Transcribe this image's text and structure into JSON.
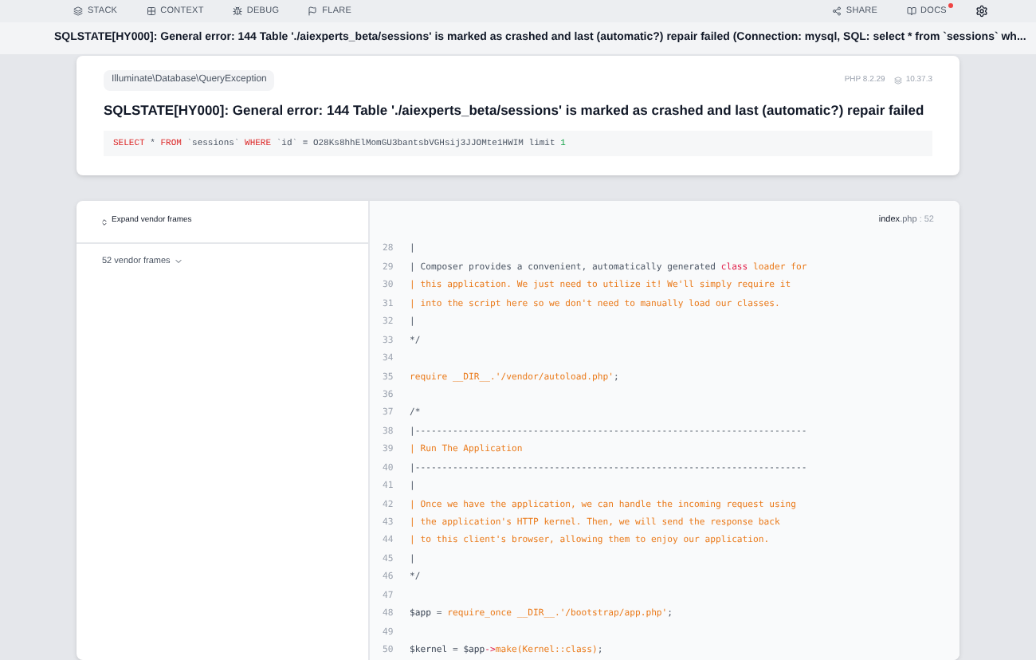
{
  "nav": {
    "tabs": [
      {
        "label": "STACK",
        "kind": "stack"
      },
      {
        "label": "CONTEXT",
        "kind": "context"
      },
      {
        "label": "DEBUG",
        "kind": "debug"
      },
      {
        "label": "FLARE",
        "kind": "flare"
      }
    ],
    "share": "SHARE",
    "docs": "DOCS"
  },
  "title_bar": "SQLSTATE[HY000]: General error: 144 Table './aiexperts_beta/sessions' is marked as crashed and last (automatic?) repair failed (Connection: mysql, SQL: select * from `sessions` wh...",
  "exception": {
    "class": "Illuminate\\Database\\QueryException",
    "php_version": "PHP 8.2.29",
    "laravel_version": "10.37.3",
    "message": "SQLSTATE[HY000]: General error: 144 Table './aiexperts_beta/sessions' is marked as crashed and last (automatic?) repair failed",
    "sql": [
      {
        "text": "SELECT",
        "kind": "keyword"
      },
      {
        "text": " * ",
        "kind": "plain"
      },
      {
        "text": "FROM",
        "kind": "keyword"
      },
      {
        "text": " `sessions` ",
        "kind": "plain"
      },
      {
        "text": "WHERE",
        "kind": "keyword"
      },
      {
        "text": " `id` = O28Ks8hhElMomGU3bantsbVGHsij3JJOMte1HWIM limit ",
        "kind": "plain"
      },
      {
        "text": "1",
        "kind": "number"
      }
    ]
  },
  "frames": {
    "expand_button": "Expand vendor frames",
    "vendor_frames": "52 vendor frames"
  },
  "code": {
    "file": "index",
    "ext": ".php",
    "line": ": 52",
    "lines": [
      {
        "number": "28",
        "segments": [
          {
            "text": "|",
            "kind": "plain"
          }
        ]
      },
      {
        "number": "29",
        "segments": [
          {
            "text": "| Composer provides a convenient, automatically generated ",
            "kind": "plain"
          },
          {
            "text": "class ",
            "kind": "keyword"
          },
          {
            "text": "loader for",
            "kind": "doc"
          }
        ]
      },
      {
        "number": "30",
        "segments": [
          {
            "text": "| this application. We just need to utilize it! We'll simply require it",
            "kind": "doc"
          }
        ]
      },
      {
        "number": "31",
        "segments": [
          {
            "text": "| into the script here so we don't need to manually load our classes.",
            "kind": "doc"
          }
        ]
      },
      {
        "number": "32",
        "segments": [
          {
            "text": "|",
            "kind": "plain"
          }
        ]
      },
      {
        "number": "33",
        "segments": [
          {
            "text": "*/",
            "kind": "plain"
          }
        ]
      },
      {
        "number": "34"
      },
      {
        "number": "35",
        "segments": [
          {
            "text": "require __DIR__.'/vendor/autoload.php'",
            "kind": "doc"
          },
          {
            "text": ";",
            "kind": "plain"
          }
        ]
      },
      {
        "number": "36"
      },
      {
        "number": "37",
        "segments": [
          {
            "text": "/*",
            "kind": "plain"
          }
        ]
      },
      {
        "number": "38",
        "segments": [
          {
            "text": "|-------------------------------------------------------------------------",
            "kind": "plain"
          }
        ]
      },
      {
        "number": "39",
        "segments": [
          {
            "text": "| Run The Application",
            "kind": "doc"
          }
        ]
      },
      {
        "number": "40",
        "segments": [
          {
            "text": "|-------------------------------------------------------------------------",
            "kind": "plain"
          }
        ]
      },
      {
        "number": "41",
        "segments": [
          {
            "text": "|",
            "kind": "plain"
          }
        ]
      },
      {
        "number": "42",
        "segments": [
          {
            "text": "| Once we have the application, we can handle the incoming request using",
            "kind": "doc"
          }
        ]
      },
      {
        "number": "43",
        "segments": [
          {
            "text": "| the application's HTTP kernel. Then, we will send the response back",
            "kind": "doc"
          }
        ]
      },
      {
        "number": "44",
        "segments": [
          {
            "text": "| to this client's browser, allowing them to enjoy our application.",
            "kind": "doc"
          }
        ]
      },
      {
        "number": "45",
        "segments": [
          {
            "text": "|",
            "kind": "plain"
          }
        ]
      },
      {
        "number": "46",
        "segments": [
          {
            "text": "*/",
            "kind": "plain"
          }
        ]
      },
      {
        "number": "47"
      },
      {
        "number": "48",
        "segments": [
          {
            "text": "$app",
            "kind": "var"
          },
          {
            "text": " = ",
            "kind": "plain"
          },
          {
            "text": "require_once __DIR__.'/bootstrap/app.php'",
            "kind": "doc"
          },
          {
            "text": ";",
            "kind": "plain"
          }
        ]
      },
      {
        "number": "49"
      },
      {
        "number": "50",
        "segments": [
          {
            "text": "$kernel",
            "kind": "var"
          },
          {
            "text": " = ",
            "kind": "plain"
          },
          {
            "text": "$app",
            "kind": "var"
          },
          {
            "text": "->",
            "kind": "keyword"
          },
          {
            "text": "make(Kernel::class)",
            "kind": "doc"
          },
          {
            "text": ";",
            "kind": "plain"
          }
        ]
      }
    ]
  }
}
